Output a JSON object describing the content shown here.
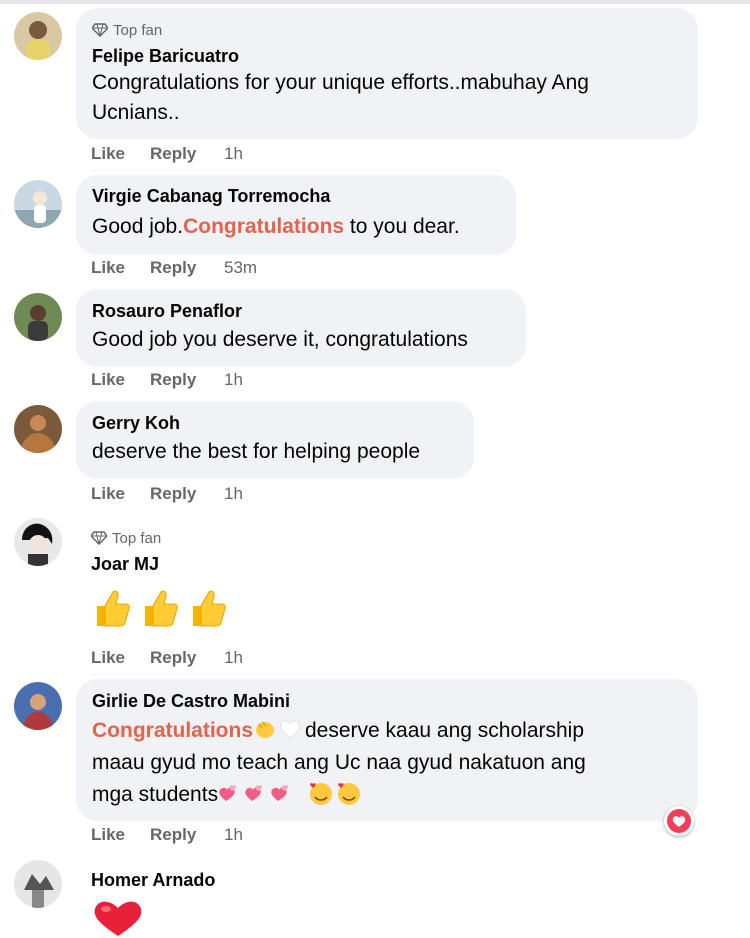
{
  "comments": [
    {
      "badge": "Top fan",
      "author": "Felipe Baricuatro",
      "text_line1": "Congratulations for your unique efforts..mabuhay Ang",
      "text_line2": "Ucnians..",
      "like": "Like",
      "reply": "Reply",
      "time": "1h"
    },
    {
      "author": "Virgie Cabanag Torremocha",
      "text_pre": "Good job.",
      "text_hl": "Congratulations",
      "text_post": " to you dear.",
      "like": "Like",
      "reply": "Reply",
      "time": "53m"
    },
    {
      "author": "Rosauro Penaflor",
      "text": "Good job you deserve it, congratulations",
      "like": "Like",
      "reply": "Reply",
      "time": "1h"
    },
    {
      "author": "Gerry Koh",
      "text": "deserve the best for helping people",
      "like": "Like",
      "reply": "Reply",
      "time": "1h"
    },
    {
      "badge": "Top fan",
      "author": "Joar MJ",
      "emoji": [
        "thumbs-up",
        "thumbs-up",
        "thumbs-up"
      ],
      "like": "Like",
      "reply": "Reply",
      "time": "1h"
    },
    {
      "author": "Girlie De Castro Mabini",
      "text_hl": "Congratulations",
      "text_line1_post": "deserve kaau ang scholarship",
      "text_line2": "maau gyud mo teach ang Uc naa gyud nakatuon ang",
      "text_line3": "mga students",
      "reaction": "heart",
      "like": "Like",
      "reply": "Reply",
      "time": "1h"
    },
    {
      "author": "Homer Arnado",
      "emoji": [
        "red-heart"
      ]
    }
  ],
  "colors": {
    "bubble": "#f0f2f5",
    "highlight": "#e4634a",
    "meta": "#65676b",
    "heart": "#f33e58"
  }
}
